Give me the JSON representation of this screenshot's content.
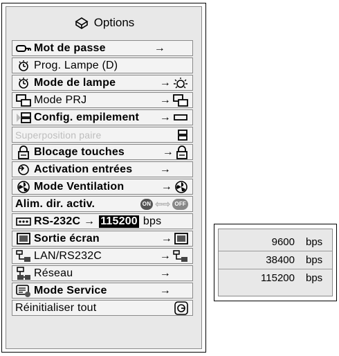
{
  "menu": {
    "title": "Options",
    "items": [
      {
        "label": "Mot de passe",
        "icon": "key-icon",
        "right": "→",
        "right_icon": ""
      },
      {
        "label": "Prog. Lampe (D)",
        "icon": "lamp-timer-icon",
        "right": "",
        "right_icon": ""
      },
      {
        "label": "Mode de lampe",
        "icon": "lamp-timer-icon",
        "right": "→",
        "right_icon": "lamp-icon"
      },
      {
        "label": "Mode PRJ",
        "icon": "prj-mode-icon",
        "right": "→",
        "right_icon": "prj-mode-icon"
      },
      {
        "label": "Config. empilement",
        "icon": "stack-icon",
        "right": "→",
        "right_icon": "bar-icon"
      },
      {
        "label": "Superposition paire",
        "icon": "",
        "right": "",
        "right_icon": "stack-pair-icon",
        "disabled": true
      },
      {
        "label": "Blocage touches",
        "icon": "lock-icon",
        "right": "→",
        "right_icon": "lock-icon"
      },
      {
        "label": "Activation entrées",
        "icon": "input-icon",
        "right": "→",
        "right_icon": ""
      },
      {
        "label": "Mode Ventilation",
        "icon": "fan-icon",
        "right": "→",
        "right_icon": "fan-icon"
      },
      {
        "label": "Alim. dir. activ.",
        "icon": "",
        "on_text": "ON",
        "off_text": "OFF",
        "swap": "⇦⇨"
      },
      {
        "label": "RS-232C",
        "icon": "rs232c-icon",
        "right": "→",
        "value": "115200",
        "unit": "bps"
      },
      {
        "label": "Sortie écran",
        "icon": "screen-icon",
        "right": "→",
        "right_icon": "screen-icon"
      },
      {
        "label": "LAN/RS232C",
        "icon": "lan-icon",
        "right": "→",
        "right_icon": "lan-icon"
      },
      {
        "label": "Réseau",
        "icon": "network-icon",
        "right": "→",
        "right_icon": ""
      },
      {
        "label": "Mode Service",
        "icon": "service-icon",
        "right": "→",
        "right_icon": ""
      },
      {
        "label": "Réinitialiser tout",
        "icon": "",
        "right": "",
        "right_icon": "reset-icon"
      }
    ]
  },
  "popup": {
    "options": [
      {
        "value": "9600",
        "unit": "bps"
      },
      {
        "value": "38400",
        "unit": "bps"
      },
      {
        "value": "115200",
        "unit": "bps"
      }
    ]
  }
}
